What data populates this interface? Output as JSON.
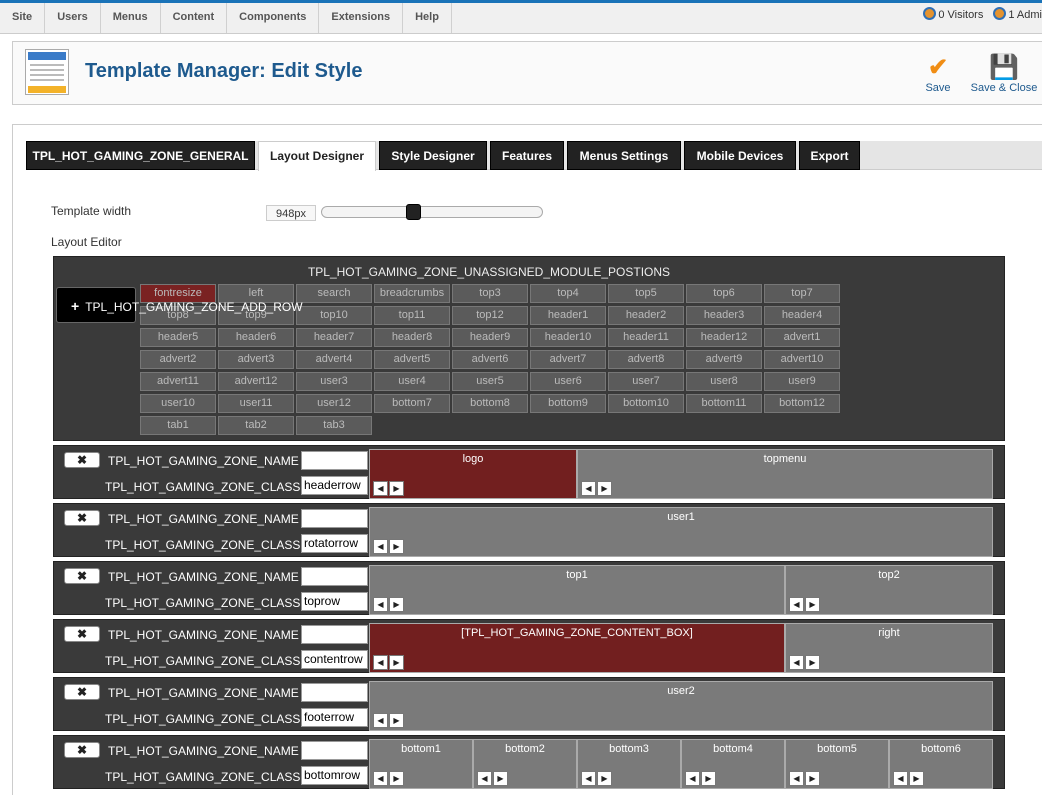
{
  "topbar": {
    "menus": [
      "Site",
      "Users",
      "Menus",
      "Content",
      "Components",
      "Extensions",
      "Help"
    ],
    "visitors": "0 Visitors",
    "admins": "1 Admi"
  },
  "header": {
    "title": "Template Manager: Edit Style",
    "save_label": "Save",
    "save_close_label": "Save & Close"
  },
  "tabs": [
    "TPL_HOT_GAMING_ZONE_GENERAL",
    "Layout Designer",
    "Style Designer",
    "Features",
    "Menus Settings",
    "Mobile Devices",
    "Export"
  ],
  "layout": {
    "template_width_label": "Template width",
    "template_width_value": "948px",
    "layout_editor_label": "Layout Editor",
    "unassigned_title": "TPL_HOT_GAMING_ZONE_UNASSIGNED_MODULE_POSTIONS",
    "add_row_label": "TPL_HOT_GAMING_ZONE_ADD_ROW",
    "unassigned_positions": [
      "fontresize",
      "left",
      "search",
      "breadcrumbs",
      "top3",
      "top4",
      "top5",
      "top6",
      "top7",
      "top8",
      "top9",
      "top10",
      "top11",
      "top12",
      "header1",
      "header2",
      "header3",
      "header4",
      "header5",
      "header6",
      "header7",
      "header8",
      "header9",
      "header10",
      "header11",
      "header12",
      "advert1",
      "advert2",
      "advert3",
      "advert4",
      "advert5",
      "advert6",
      "advert7",
      "advert8",
      "advert9",
      "advert10",
      "advert11",
      "advert12",
      "user3",
      "user4",
      "user5",
      "user6",
      "user7",
      "user8",
      "user9",
      "user10",
      "user11",
      "user12",
      "bottom7",
      "bottom8",
      "bottom9",
      "bottom10",
      "bottom11",
      "bottom12",
      "tab1",
      "tab2",
      "tab3"
    ],
    "name_label": "TPL_HOT_GAMING_ZONE_NAME",
    "class_label": "TPL_HOT_GAMING_ZONE_CLASS",
    "rows": [
      {
        "class": "headerrow",
        "columns": [
          "logo",
          "topmenu"
        ]
      },
      {
        "class": "rotatorrow",
        "columns": [
          "user1"
        ]
      },
      {
        "class": "toprow",
        "columns": [
          "top1",
          "top2"
        ]
      },
      {
        "class": "contentrow",
        "columns": [
          "[TPL_HOT_GAMING_ZONE_CONTENT_BOX]",
          "right"
        ]
      },
      {
        "class": "footerrow",
        "columns": [
          "user2"
        ]
      },
      {
        "class": "bottomrow",
        "columns": [
          "bottom1",
          "bottom2",
          "bottom3",
          "bottom4",
          "bottom5",
          "bottom6"
        ]
      }
    ]
  },
  "colors": {
    "accent": "#1a73b8",
    "brand_title": "#1e5a8e",
    "highlight": "#7a2222"
  }
}
